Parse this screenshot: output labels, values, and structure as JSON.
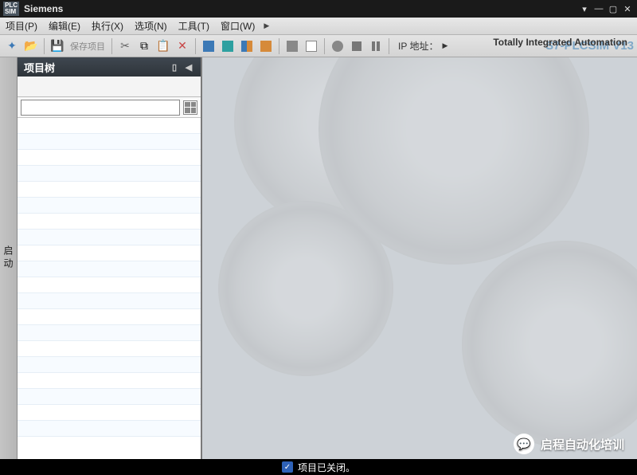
{
  "titlebar": {
    "logo": "PLC\nSIM",
    "app": "Siemens"
  },
  "menu": {
    "items": [
      "项目(P)",
      "编辑(E)",
      "执行(X)",
      "选项(N)",
      "工具(T)",
      "窗口(W)"
    ]
  },
  "brand": {
    "top": "Totally Integrated Automation",
    "sub": "S7-PLCSIM V13"
  },
  "toolbar": {
    "save_project": "保存项目",
    "ip_label": "IP 地址："
  },
  "tree": {
    "title": "项目树",
    "filter_placeholder": ""
  },
  "side_tab": {
    "label": "启动"
  },
  "status": {
    "icon": "✓",
    "text": "项目已关闭。"
  },
  "watermark": {
    "text": "启程自动化培训"
  }
}
